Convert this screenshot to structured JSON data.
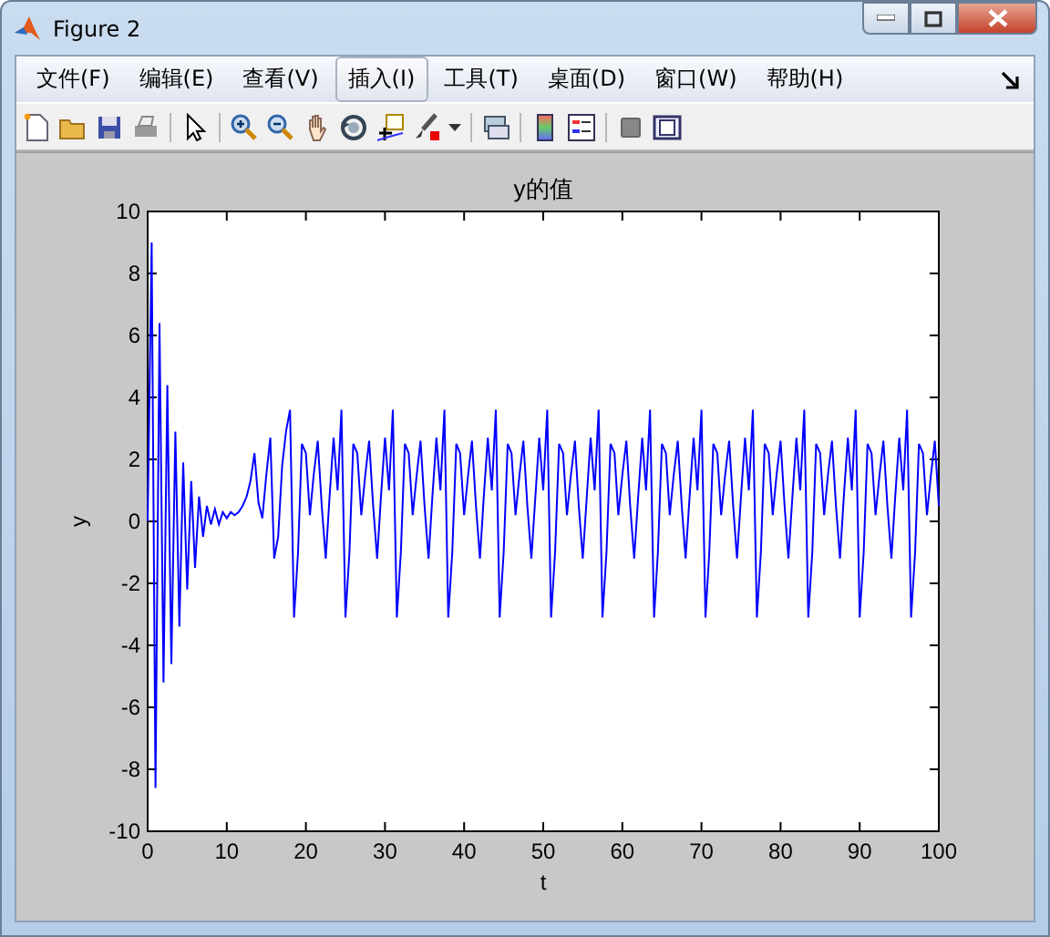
{
  "window": {
    "title": "Figure 2"
  },
  "menu": [
    {
      "label": "文件(F)",
      "highlighted": false
    },
    {
      "label": "编辑(E)",
      "highlighted": false
    },
    {
      "label": "查看(V)",
      "highlighted": false
    },
    {
      "label": "插入(I)",
      "highlighted": true
    },
    {
      "label": "工具(T)",
      "highlighted": false
    },
    {
      "label": "桌面(D)",
      "highlighted": false
    },
    {
      "label": "窗口(W)",
      "highlighted": false
    },
    {
      "label": "帮助(H)",
      "highlighted": false
    }
  ],
  "plot": {
    "chart_data": {
      "type": "line",
      "title": "y的值",
      "xlabel": "t",
      "ylabel": "y",
      "xlim": [
        0,
        100
      ],
      "ylim": [
        -10,
        10
      ],
      "xticks": [
        0,
        10,
        20,
        30,
        40,
        50,
        60,
        70,
        80,
        90,
        100
      ],
      "x": [
        0,
        0.5,
        1,
        1.5,
        2,
        2.5,
        3,
        3.5,
        4,
        4.5,
        5,
        5.5,
        6,
        6.5,
        7,
        7.5,
        8,
        8.5,
        9,
        9.5,
        10,
        10.5,
        11,
        11.5,
        12,
        12.5,
        13,
        13.5,
        14,
        14.5,
        15,
        15.5,
        16,
        16.5,
        17,
        17.5,
        18,
        18.5,
        19,
        19.5,
        20,
        20.5,
        21,
        21.5,
        22,
        22.5,
        23,
        23.5,
        24,
        24.5,
        25,
        25.5,
        26,
        26.5,
        27,
        27.5,
        28,
        28.5,
        29,
        29.5,
        30,
        30.5,
        31,
        31.5,
        32,
        32.5,
        33,
        33.5,
        34,
        34.5,
        35,
        35.5,
        36,
        36.5,
        37,
        37.5,
        38,
        38.5,
        39,
        39.5,
        40,
        40.5,
        41,
        41.5,
        42,
        42.5,
        43,
        43.5,
        44,
        44.5,
        45,
        45.5,
        46,
        46.5,
        47,
        47.5,
        48,
        48.5,
        49,
        49.5,
        50,
        50.5,
        51,
        51.5,
        52,
        52.5,
        53,
        53.5,
        54,
        54.5,
        55,
        55.5,
        56,
        56.5,
        57,
        57.5,
        58,
        58.5,
        59,
        59.5,
        60,
        60.5,
        61,
        61.5,
        62,
        62.5,
        63,
        63.5,
        64,
        64.5,
        65,
        65.5,
        66,
        66.5,
        67,
        67.5,
        68,
        68.5,
        69,
        69.5,
        70,
        70.5,
        71,
        71.5,
        72,
        72.5,
        73,
        73.5,
        74,
        74.5,
        75,
        75.5,
        76,
        76.5,
        77,
        77.5,
        78,
        78.5,
        79,
        79.5,
        80,
        80.5,
        81,
        81.5,
        82,
        82.5,
        83,
        83.5,
        84,
        84.5,
        85,
        85.5,
        86,
        86.5,
        87,
        87.5,
        88,
        88.5,
        89,
        89.5,
        90,
        90.5,
        91,
        91.5,
        92,
        92.5,
        93,
        93.5,
        94,
        94.5,
        95,
        95.5,
        96,
        96.5,
        97,
        97.5,
        98,
        98.5,
        99,
        99.5,
        100
      ],
      "yticks": [
        -10,
        -8,
        -6,
        -4,
        -2,
        0,
        2,
        4,
        6,
        8,
        10
      ],
      "series": [
        {
          "color": "#0000ff",
          "values": [
            0,
            9,
            -8.6,
            6.4,
            -5.2,
            4.4,
            -4.6,
            2.9,
            -3.4,
            1.9,
            -2.2,
            1.3,
            -1.5,
            0.8,
            -0.5,
            0.5,
            -0.1,
            0.4,
            -0.1,
            0.3,
            0.1,
            0.3,
            0.2,
            0.3,
            0.5,
            0.8,
            1.3,
            2.2,
            0.6,
            0.1,
            1.5,
            2.7,
            -1.2,
            -0.5,
            1.8,
            2.9,
            3.6,
            -3.1,
            -1.0,
            2.5,
            2.2,
            0.2,
            1.5,
            2.6,
            0.5,
            -1.2,
            0.8,
            2.7,
            1.0,
            3.6,
            -3.1,
            -1.0,
            2.5,
            2.2,
            0.2,
            1.5,
            2.6,
            0.5,
            -1.2,
            0.8,
            2.7,
            1.0,
            3.6,
            -3.1,
            -1.0,
            2.5,
            2.2,
            0.2,
            1.5,
            2.6,
            0.5,
            -1.2,
            0.8,
            2.7,
            1.0,
            3.6,
            -3.1,
            -1.0,
            2.5,
            2.2,
            0.2,
            1.5,
            2.6,
            0.5,
            -1.2,
            0.8,
            2.7,
            1.0,
            3.6,
            -3.1,
            -1.0,
            2.5,
            2.2,
            0.2,
            1.5,
            2.6,
            0.5,
            -1.2,
            0.8,
            2.7,
            1.0,
            3.6,
            -3.1,
            -1.0,
            2.5,
            2.2,
            0.2,
            1.5,
            2.6,
            0.5,
            -1.2,
            0.8,
            2.7,
            1.0,
            3.6,
            -3.1,
            -1.0,
            2.5,
            2.2,
            0.2,
            1.5,
            2.6,
            0.5,
            -1.2,
            0.8,
            2.7,
            1.0,
            3.6,
            -3.1,
            -1.0,
            2.5,
            2.2,
            0.2,
            1.5,
            2.6,
            0.5,
            -1.2,
            0.8,
            2.7,
            1.0,
            3.6,
            -3.1,
            -1.0,
            2.5,
            2.2,
            0.2,
            1.5,
            2.6,
            0.5,
            -1.2,
            0.8,
            2.7,
            1.0,
            3.6,
            -3.1,
            -1.0,
            2.5,
            2.2,
            0.2,
            1.5,
            2.6,
            0.5,
            -1.2,
            0.8,
            2.7,
            1.0,
            3.6,
            -3.1,
            -1.0,
            2.5,
            2.2,
            0.2,
            1.5,
            2.6,
            0.5,
            -1.2,
            0.8,
            2.7,
            1.0,
            3.6,
            -3.1,
            -1.0,
            2.5,
            2.2,
            0.2,
            1.5,
            2.6,
            0.5,
            -1.2,
            0.8,
            2.7,
            1.0,
            3.6,
            -3.1,
            -1.0,
            2.5,
            2.2,
            0.2,
            1.5,
            2.6,
            0.5
          ]
        }
      ]
    }
  }
}
